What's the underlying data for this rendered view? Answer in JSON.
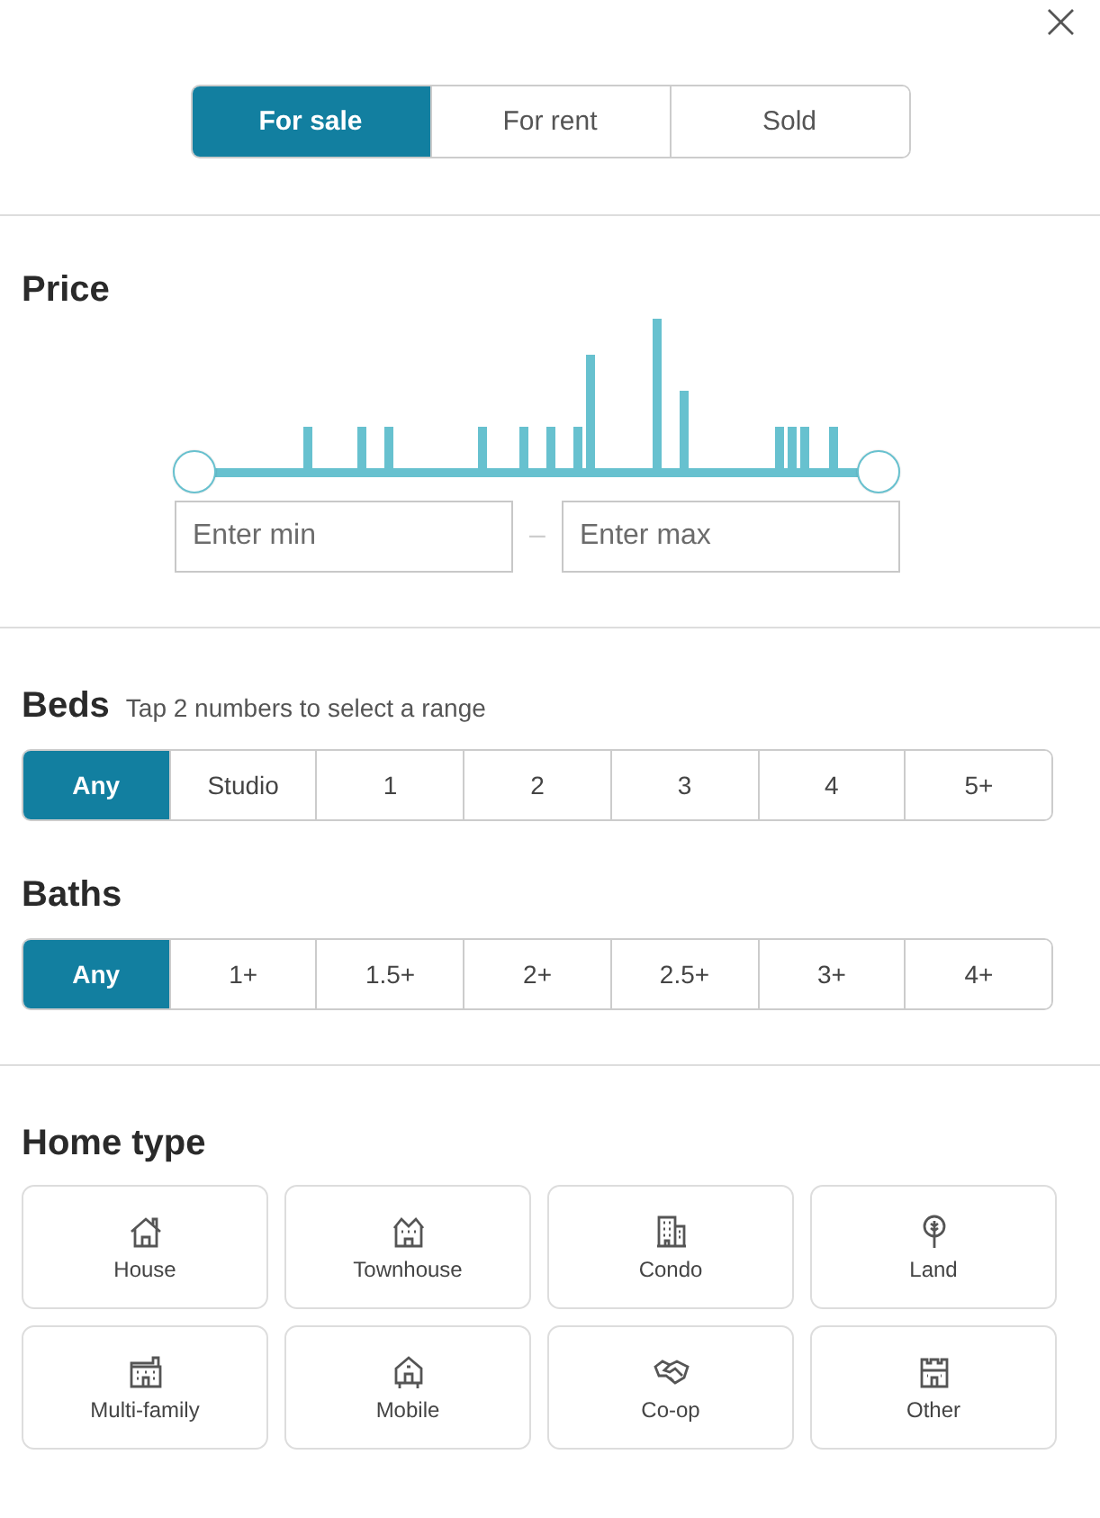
{
  "close": {
    "label": "×"
  },
  "listing_tabs": [
    {
      "label": "For sale",
      "selected": true
    },
    {
      "label": "For rent",
      "selected": false
    },
    {
      "label": "Sold",
      "selected": false
    }
  ],
  "price": {
    "title": "Price",
    "slider": {
      "thumbs": [
        {
          "level": 0
        },
        {
          "level": 1
        }
      ]
    },
    "min": {
      "placeholder": "Enter min"
    },
    "separator": "–",
    "max": {
      "placeholder": "Enter max"
    }
  },
  "beds": {
    "title": "Beds",
    "hint": "Tap 2 numbers to select a range",
    "options": [
      {
        "label": "Any",
        "selected": true
      },
      {
        "label": "Studio",
        "selected": false
      },
      {
        "label": "1",
        "selected": false
      },
      {
        "label": "2",
        "selected": false
      },
      {
        "label": "3",
        "selected": false
      },
      {
        "label": "4",
        "selected": false
      },
      {
        "label": "5+",
        "selected": false
      }
    ]
  },
  "baths": {
    "title": "Baths",
    "options": [
      {
        "label": "Any",
        "selected": true
      },
      {
        "label": "1+",
        "selected": false
      },
      {
        "label": "1.5+",
        "selected": false
      },
      {
        "label": "2+",
        "selected": false
      },
      {
        "label": "2.5+",
        "selected": false
      },
      {
        "label": "3+",
        "selected": false
      },
      {
        "label": "4+",
        "selected": false
      }
    ]
  },
  "home_type": {
    "title": "Home type",
    "items": [
      {
        "label": "House",
        "selected": false
      },
      {
        "label": "Townhouse",
        "selected": false
      },
      {
        "label": "Condo",
        "selected": false
      },
      {
        "label": "Land",
        "selected": false
      },
      {
        "label": "Multi-family",
        "selected": false
      },
      {
        "label": "Mobile",
        "selected": false
      },
      {
        "label": "Co-op",
        "selected": false
      },
      {
        "label": "Other",
        "selected": false
      }
    ]
  }
}
